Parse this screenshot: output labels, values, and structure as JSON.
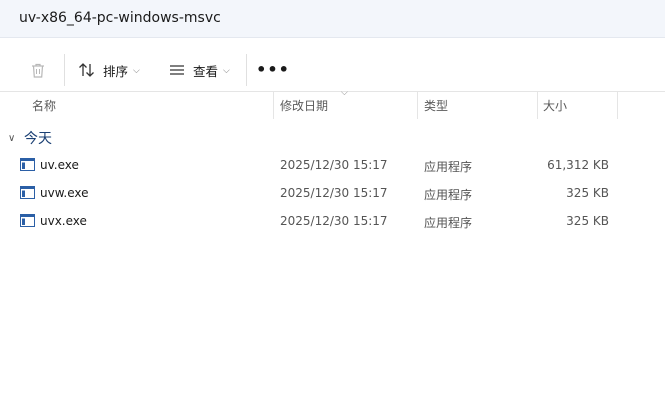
{
  "address": {
    "path": "uv-x86_64-pc-windows-msvc"
  },
  "toolbar": {
    "delete_icon": "trash-icon",
    "sort_label": "排序",
    "sort_icon": "sort-arrows-icon",
    "view_label": "查看",
    "view_icon": "lines-icon",
    "more_label": "•••"
  },
  "columns": {
    "name": "名称",
    "date": "修改日期",
    "type": "类型",
    "size": "大小"
  },
  "group": {
    "label": "今天"
  },
  "files": [
    {
      "name": "uv.exe",
      "date": "2025/12/30 15:17",
      "type": "应用程序",
      "size": "61,312 KB"
    },
    {
      "name": "uvw.exe",
      "date": "2025/12/30 15:17",
      "type": "应用程序",
      "size": "325 KB"
    },
    {
      "name": "uvx.exe",
      "date": "2025/12/30 15:17",
      "type": "应用程序",
      "size": "325 KB"
    }
  ],
  "colors": {
    "address_bg": "#f3f6fb",
    "group_label": "#1a3f73",
    "app_icon_blue": "#2b5fa6"
  }
}
